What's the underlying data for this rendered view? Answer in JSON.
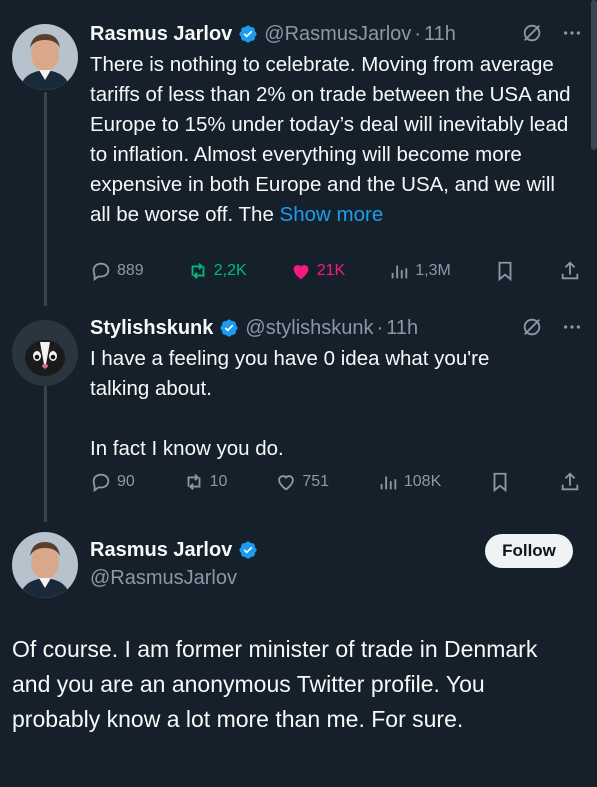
{
  "tweets": [
    {
      "name": "Rasmus Jarlov",
      "handle": "@RasmusJarlov",
      "time": "11h",
      "text_main": "There is nothing to celebrate. Moving from average tariffs of less than 2% on trade between the USA and Europe to 15% under today’s deal will inevitably lead to inflation. Almost everything will become more expensive in both Europe and the USA, and we will all be worse off. The ",
      "show_more": "Show more",
      "replies": "889",
      "retweets": "2,2K",
      "likes": "21K",
      "views": "1,3M"
    },
    {
      "name": "Stylishskunk",
      "handle": "@stylishskunk",
      "time": "11h",
      "text_line1": "I have a feeling you have 0 idea what you're talking about.",
      "text_line2": "In fact I know you do.",
      "replies": "90",
      "retweets": "10",
      "likes": "751",
      "views": "108K"
    }
  ],
  "main_tweet": {
    "name": "Rasmus Jarlov",
    "handle": "@RasmusJarlov",
    "follow_label": "Follow",
    "text": "Of course. I am former minister of trade in Denmark and you are an anonymous Twitter profile. You probably know a lot more than me. For sure."
  },
  "colors": {
    "background": "#15202b",
    "link": "#1d9bf0",
    "retweet": "#00ba7c",
    "like": "#f91880",
    "verified": "#1d9bf0"
  },
  "icons": [
    "verified-badge-icon",
    "grok-icon",
    "more-icon",
    "reply-icon",
    "retweet-icon",
    "like-icon",
    "views-icon",
    "bookmark-icon",
    "share-icon"
  ]
}
